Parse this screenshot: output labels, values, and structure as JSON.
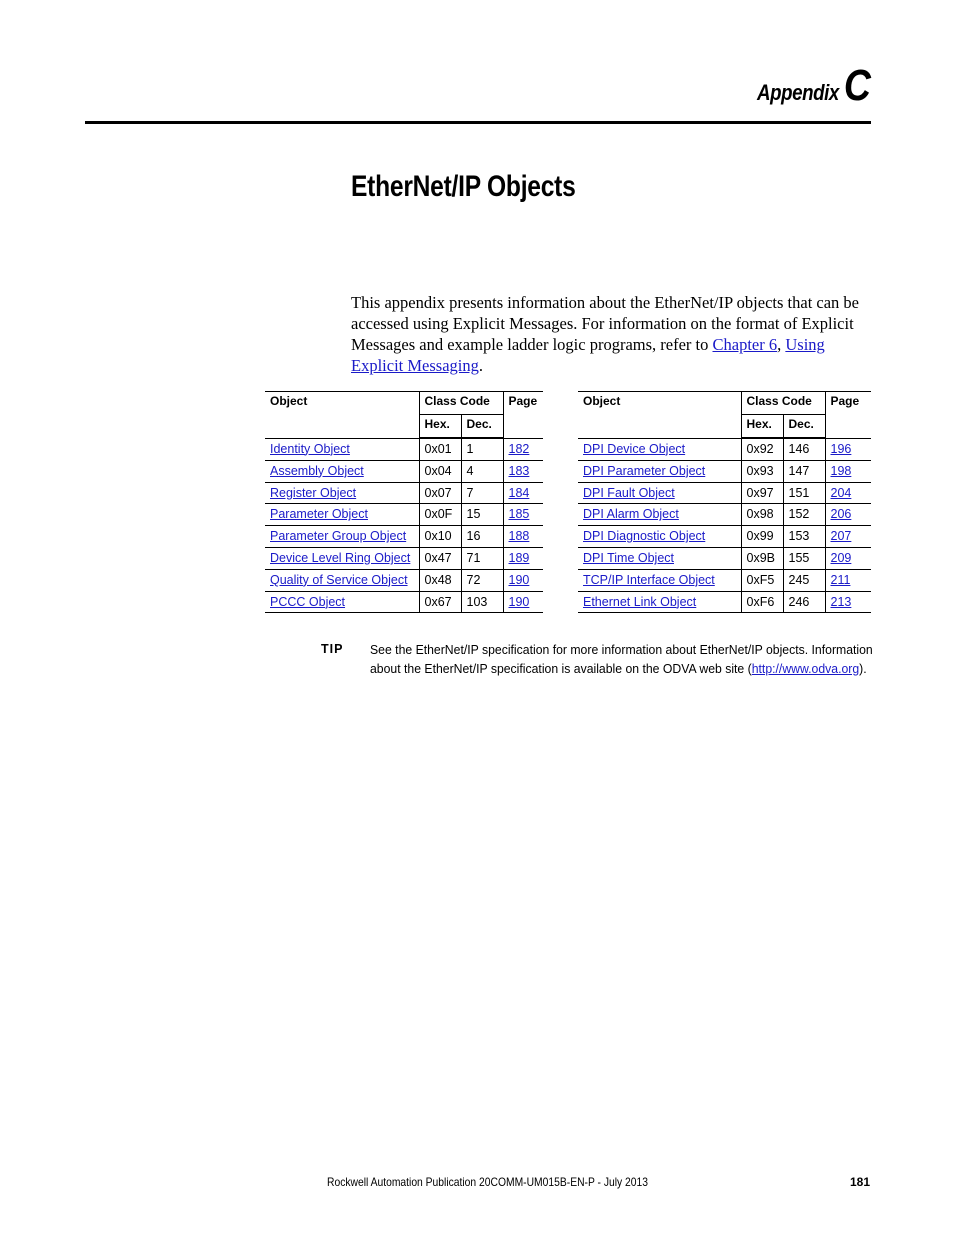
{
  "header": {
    "appendix_word": "Appendix",
    "appendix_letter": "C"
  },
  "page_title": "EtherNet/IP Objects",
  "intro": {
    "text_before": "This appendix presents information about the EtherNet/IP objects that can be accessed using Explicit Messages. For information on the format of Explicit Messages and example ladder logic programs, refer to ",
    "link1": "Chapter 6",
    "sep": ", ",
    "link2": "Using Explicit Messaging",
    "text_after": "."
  },
  "table_headers": {
    "object": "Object",
    "class_code": "Class Code",
    "page": "Page",
    "hex": "Hex.",
    "dec": "Dec."
  },
  "left_table": [
    {
      "object": "Identity Object",
      "hex": "0x01",
      "dec": "1",
      "page": "182"
    },
    {
      "object": "Assembly Object",
      "hex": "0x04",
      "dec": "4",
      "page": "183"
    },
    {
      "object": "Register Object",
      "hex": "0x07",
      "dec": "7",
      "page": "184"
    },
    {
      "object": "Parameter Object",
      "hex": "0x0F",
      "dec": "15",
      "page": "185"
    },
    {
      "object": "Parameter Group Object",
      "hex": "0x10",
      "dec": "16",
      "page": "188"
    },
    {
      "object": "Device Level Ring Object",
      "hex": "0x47",
      "dec": "71",
      "page": "189"
    },
    {
      "object": "Quality of Service Object",
      "hex": "0x48",
      "dec": "72",
      "page": "190"
    },
    {
      "object": "PCCC Object",
      "hex": "0x67",
      "dec": "103",
      "page": "190"
    }
  ],
  "right_table": [
    {
      "object": "DPI Device Object",
      "hex": "0x92",
      "dec": "146",
      "page": "196"
    },
    {
      "object": "DPI Parameter Object",
      "hex": "0x93",
      "dec": "147",
      "page": "198"
    },
    {
      "object": "DPI Fault Object",
      "hex": "0x97",
      "dec": "151",
      "page": "204"
    },
    {
      "object": "DPI Alarm Object",
      "hex": "0x98",
      "dec": "152",
      "page": "206"
    },
    {
      "object": "DPI Diagnostic Object",
      "hex": "0x99",
      "dec": "153",
      "page": "207"
    },
    {
      "object": "DPI Time Object",
      "hex": "0x9B",
      "dec": "155",
      "page": "209"
    },
    {
      "object": "TCP/IP Interface Object",
      "hex": "0xF5",
      "dec": "245",
      "page": "211"
    },
    {
      "object": "Ethernet Link Object",
      "hex": "0xF6",
      "dec": "246",
      "page": "213"
    }
  ],
  "tip": {
    "label": "TIP",
    "text_before": "See the EtherNet/IP specification for more information about EtherNet/IP objects. Information about the EtherNet/IP specification is available on the ODVA web site (",
    "link": "http://www.odva.org",
    "text_after": ")."
  },
  "footer": {
    "publication": "Rockwell Automation Publication  20COMM-UM015B-EN-P - July 2013",
    "page_number": "181"
  },
  "colors": {
    "link": "#1a1ac8",
    "text": "#000000"
  }
}
